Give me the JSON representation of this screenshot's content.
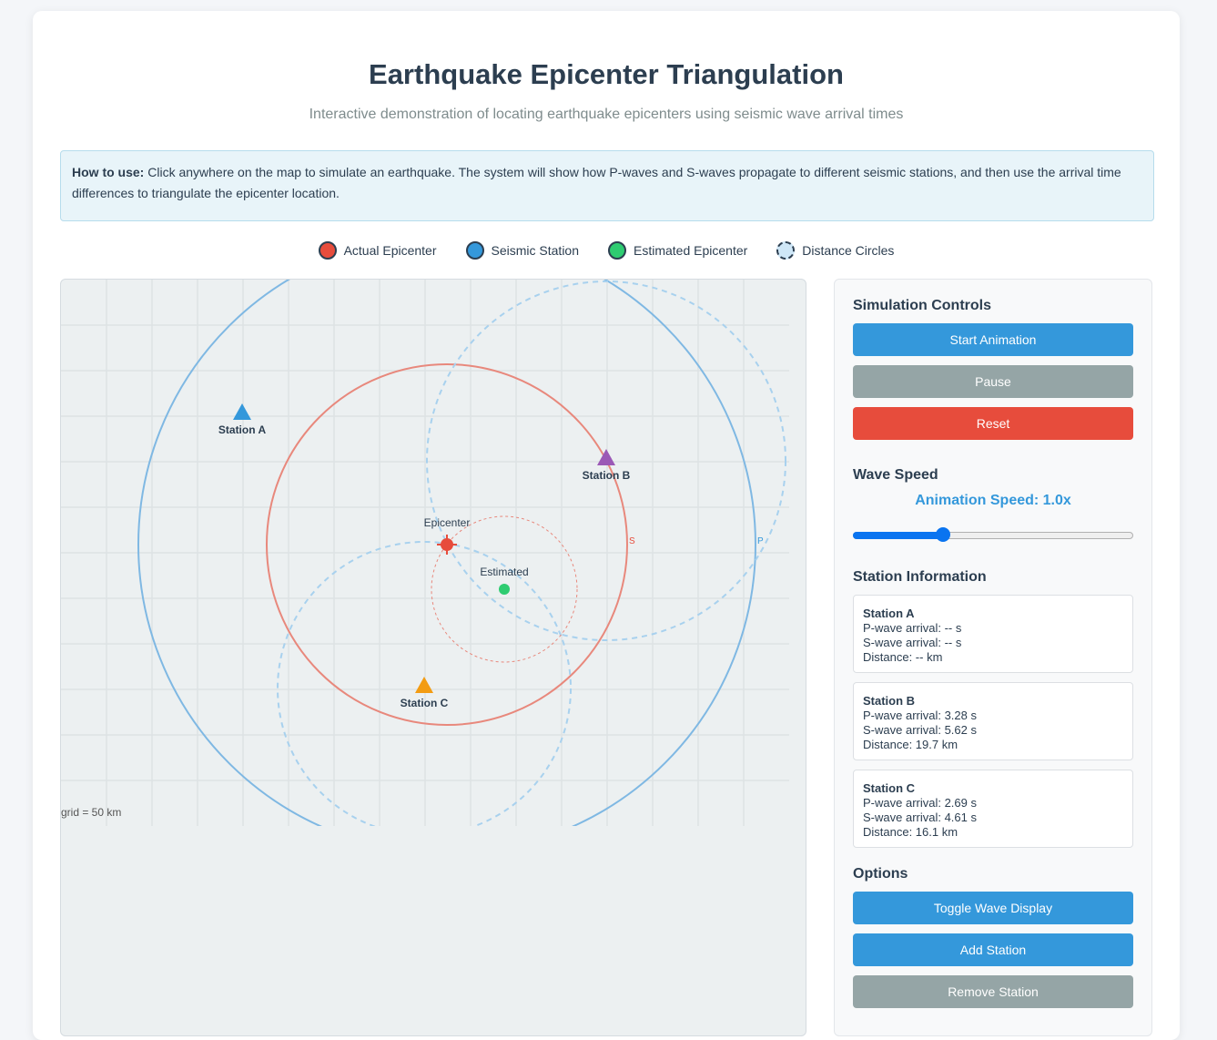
{
  "header": {
    "title": "Earthquake Epicenter Triangulation",
    "subtitle": "Interactive demonstration of locating earthquake epicenters using seismic wave arrival times"
  },
  "howto": {
    "label": "How to use:",
    "text": "Click anywhere on the map to simulate an earthquake. The system will show how P-waves and S-waves propagate to different seismic stations, and then use the arrival time differences to triangulate the epicenter location."
  },
  "legend": [
    {
      "label": "Actual Epicenter",
      "color": "#e74c3c"
    },
    {
      "label": "Seismic Station",
      "color": "#3498db"
    },
    {
      "label": "Estimated Epicenter",
      "color": "#2ecc71"
    },
    {
      "label": "Distance Circles",
      "color": "#cfe7f7"
    }
  ],
  "map": {
    "stations": [
      {
        "label": "Station A",
        "color": "#3498db"
      },
      {
        "label": "Station B",
        "color": "#9b59b6"
      },
      {
        "label": "Station C",
        "color": "#f39c12"
      }
    ],
    "epicenter_label": "Epicenter",
    "estimated_label": "Estimated",
    "s_wave_label": "S",
    "p_wave_label": "P",
    "grid_note": "grid = 50 km",
    "colors": {
      "p_wave": "#7fb8e3",
      "s_wave": "#e8887c",
      "distance_circle": "#a8d1ee",
      "epicenter": "#e74c3c",
      "estimated": "#2ecc71"
    }
  },
  "controls": {
    "title": "Simulation Controls",
    "start": "Start Animation",
    "pause": "Pause",
    "reset": "Reset"
  },
  "wave_speed": {
    "title": "Wave Speed",
    "label": "Animation Speed: 1.0x",
    "fraction": 0.32
  },
  "station_info": {
    "title": "Station Information",
    "stations": [
      {
        "name": "Station A",
        "p": "P-wave arrival: -- s",
        "s": "S-wave arrival: -- s",
        "d": "Distance: -- km"
      },
      {
        "name": "Station B",
        "p": "P-wave arrival: 3.28 s",
        "s": "S-wave arrival: 5.62 s",
        "d": "Distance: 19.7 km"
      },
      {
        "name": "Station C",
        "p": "P-wave arrival: 2.69 s",
        "s": "S-wave arrival: 4.61 s",
        "d": "Distance: 16.1 km"
      }
    ]
  },
  "options": {
    "title": "Options",
    "toggle": "Toggle Wave Display",
    "add": "Add Station",
    "remove": "Remove Station"
  }
}
